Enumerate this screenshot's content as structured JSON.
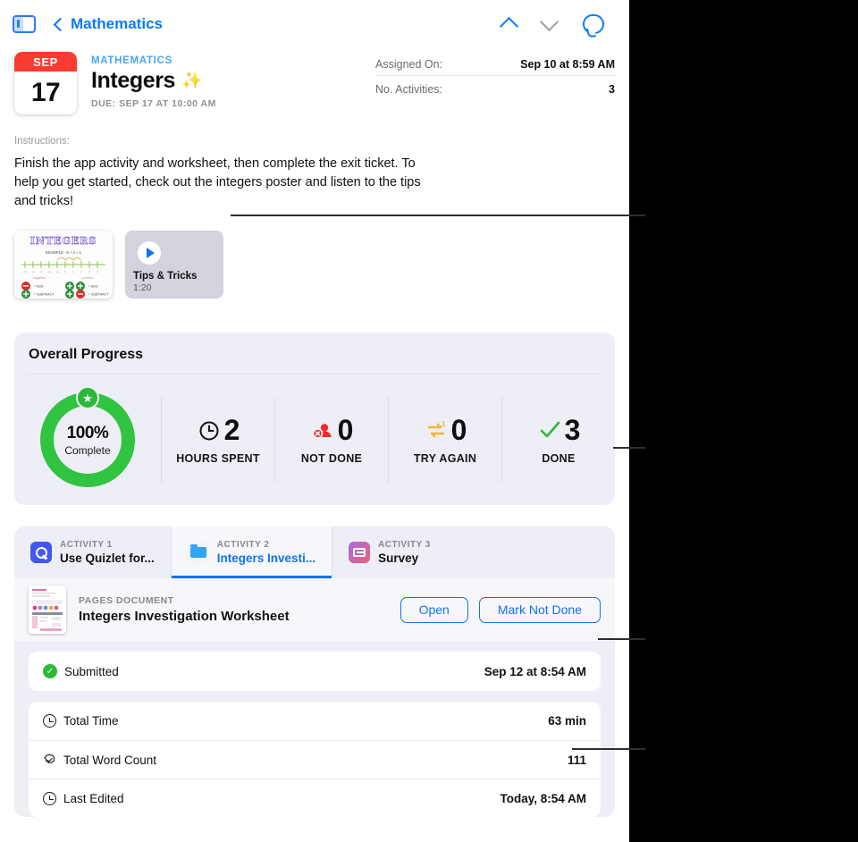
{
  "nav": {
    "sidebar_toggle": "sidebar-toggle",
    "back_label": "Mathematics",
    "prev_label": "Previous",
    "next_label": "Next",
    "comments_label": "Comments"
  },
  "header": {
    "date_month": "SEP",
    "date_day": "17",
    "eyebrow": "MATHEMATICS",
    "title": "Integers",
    "sparkle": "✨",
    "due": "DUE: SEP 17 AT 10:00 AM",
    "meta": [
      {
        "key": "Assigned On:",
        "value": "Sep 10 at 8:59 AM"
      },
      {
        "key": "No. Activities:",
        "value": "3"
      }
    ]
  },
  "instructions": {
    "label": "Instructions:",
    "body": "Finish the app activity and worksheet, then complete the exit ticket. To help you get started, check out the integers poster and listen to the tips and tricks!"
  },
  "attachments": {
    "poster": {
      "name": "INTEGERS",
      "example": "EXAMPLE: -5 + 4 = 1",
      "left_label": "negative",
      "right_label": "positive"
    },
    "video": {
      "title": "Tips & Tricks",
      "duration": "1:20"
    }
  },
  "progress": {
    "card_title": "Overall Progress",
    "percent": "100%",
    "percent_sub": "Complete",
    "stats": [
      {
        "value": "2",
        "label": "HOURS SPENT",
        "icon": "clock-icon",
        "color": "#0d0d0d"
      },
      {
        "value": "0",
        "label": "NOT DONE",
        "icon": "not-done-icon",
        "color": "#ec2b2b"
      },
      {
        "value": "0",
        "label": "TRY AGAIN",
        "icon": "try-again-icon",
        "color": "#f7b731"
      },
      {
        "value": "3",
        "label": "DONE",
        "icon": "check-icon",
        "color": "#2ab938"
      }
    ]
  },
  "activities": {
    "tabs": [
      {
        "eyebrow": "ACTIVITY 1",
        "name": "Use Quizlet for...",
        "icon": "quizlet-icon",
        "active": false
      },
      {
        "eyebrow": "ACTIVITY 2",
        "name": "Integers Investi...",
        "icon": "folder-icon",
        "active": true
      },
      {
        "eyebrow": "ACTIVITY 3",
        "name": "Survey",
        "icon": "survey-icon",
        "active": false
      }
    ],
    "document": {
      "kind": "PAGES DOCUMENT",
      "name": "Integers Investigation Worksheet",
      "open_label": "Open",
      "mark_label": "Mark Not Done"
    },
    "submitted": {
      "label": "Submitted",
      "value": "Sep 12 at 8:54 AM"
    },
    "details": [
      {
        "label": "Total Time",
        "value": "63 min",
        "icon": "clock-icon"
      },
      {
        "label": "Total Word Count",
        "value": "111",
        "icon": "badge-check-icon"
      },
      {
        "label": "Last Edited",
        "value": "Today, 8:54 AM",
        "icon": "clock-icon"
      }
    ]
  },
  "colors": {
    "accent_blue": "#1272f0",
    "green": "#2ab938",
    "red": "#fb3b30",
    "yellow": "#f7b731",
    "card_bg": "#eeeef6"
  }
}
